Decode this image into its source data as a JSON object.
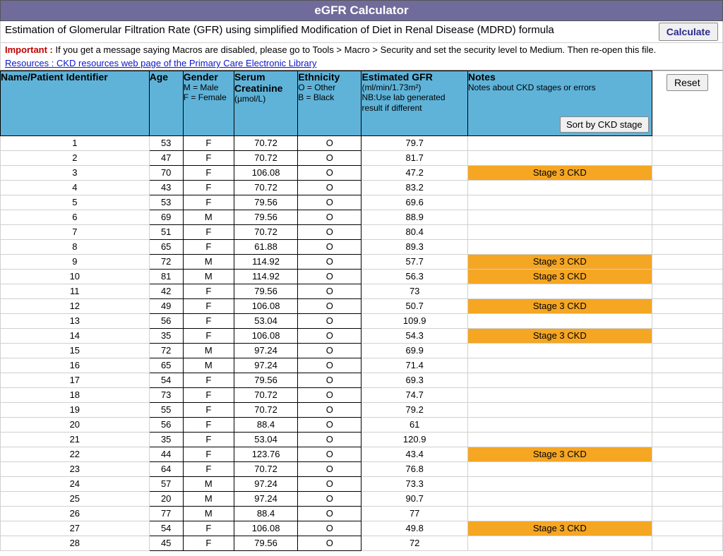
{
  "title": "eGFR Calculator",
  "subtitle": "Estimation of Glomerular Filtration Rate (GFR) using simplified Modification of Diet in Renal Disease (MDRD) formula",
  "buttons": {
    "calculate": "Calculate",
    "reset": "Reset",
    "sort": "Sort by CKD stage"
  },
  "important": {
    "label": "Important :",
    "text": " If you get a message saying Macros are disabled, please go to Tools > Macro > Security and set the security level to Medium. Then re-open this file."
  },
  "resources_link": "Resources : CKD resources web page of the Primary Care Electronic Library",
  "columns": {
    "id": {
      "title": "Name/Patient Identifier",
      "sub": ""
    },
    "age": {
      "title": "Age",
      "sub": ""
    },
    "gender": {
      "title": "Gender",
      "sub": "M = Male\nF = Female"
    },
    "creat": {
      "title": "Serum Creatinine",
      "sub": "(µmol/L)"
    },
    "eth": {
      "title": "Ethnicity",
      "sub": "O = Other\nB = Black"
    },
    "gfr": {
      "title": "Estimated GFR",
      "sub": "(ml/min/1.73m²)\nNB:Use lab generated result if different"
    },
    "notes": {
      "title": "Notes",
      "sub": "Notes about CKD stages or errors"
    }
  },
  "rows": [
    {
      "id": "1",
      "age": "53",
      "gender": "F",
      "creat": "70.72",
      "eth": "O",
      "gfr": "79.7",
      "notes": ""
    },
    {
      "id": "2",
      "age": "47",
      "gender": "F",
      "creat": "70.72",
      "eth": "O",
      "gfr": "81.7",
      "notes": ""
    },
    {
      "id": "3",
      "age": "70",
      "gender": "F",
      "creat": "106.08",
      "eth": "O",
      "gfr": "47.2",
      "notes": "Stage 3 CKD"
    },
    {
      "id": "4",
      "age": "43",
      "gender": "F",
      "creat": "70.72",
      "eth": "O",
      "gfr": "83.2",
      "notes": ""
    },
    {
      "id": "5",
      "age": "53",
      "gender": "F",
      "creat": "79.56",
      "eth": "O",
      "gfr": "69.6",
      "notes": ""
    },
    {
      "id": "6",
      "age": "69",
      "gender": "M",
      "creat": "79.56",
      "eth": "O",
      "gfr": "88.9",
      "notes": ""
    },
    {
      "id": "7",
      "age": "51",
      "gender": "F",
      "creat": "70.72",
      "eth": "O",
      "gfr": "80.4",
      "notes": ""
    },
    {
      "id": "8",
      "age": "65",
      "gender": "F",
      "creat": "61.88",
      "eth": "O",
      "gfr": "89.3",
      "notes": ""
    },
    {
      "id": "9",
      "age": "72",
      "gender": "M",
      "creat": "114.92",
      "eth": "O",
      "gfr": "57.7",
      "notes": "Stage 3 CKD"
    },
    {
      "id": "10",
      "age": "81",
      "gender": "M",
      "creat": "114.92",
      "eth": "O",
      "gfr": "56.3",
      "notes": "Stage 3 CKD"
    },
    {
      "id": "11",
      "age": "42",
      "gender": "F",
      "creat": "79.56",
      "eth": "O",
      "gfr": "73",
      "notes": ""
    },
    {
      "id": "12",
      "age": "49",
      "gender": "F",
      "creat": "106.08",
      "eth": "O",
      "gfr": "50.7",
      "notes": "Stage 3 CKD"
    },
    {
      "id": "13",
      "age": "56",
      "gender": "F",
      "creat": "53.04",
      "eth": "O",
      "gfr": "109.9",
      "notes": ""
    },
    {
      "id": "14",
      "age": "35",
      "gender": "F",
      "creat": "106.08",
      "eth": "O",
      "gfr": "54.3",
      "notes": "Stage 3 CKD"
    },
    {
      "id": "15",
      "age": "72",
      "gender": "M",
      "creat": "97.24",
      "eth": "O",
      "gfr": "69.9",
      "notes": ""
    },
    {
      "id": "16",
      "age": "65",
      "gender": "M",
      "creat": "97.24",
      "eth": "O",
      "gfr": "71.4",
      "notes": ""
    },
    {
      "id": "17",
      "age": "54",
      "gender": "F",
      "creat": "79.56",
      "eth": "O",
      "gfr": "69.3",
      "notes": ""
    },
    {
      "id": "18",
      "age": "73",
      "gender": "F",
      "creat": "70.72",
      "eth": "O",
      "gfr": "74.7",
      "notes": ""
    },
    {
      "id": "19",
      "age": "55",
      "gender": "F",
      "creat": "70.72",
      "eth": "O",
      "gfr": "79.2",
      "notes": ""
    },
    {
      "id": "20",
      "age": "56",
      "gender": "F",
      "creat": "88.4",
      "eth": "O",
      "gfr": "61",
      "notes": ""
    },
    {
      "id": "21",
      "age": "35",
      "gender": "F",
      "creat": "53.04",
      "eth": "O",
      "gfr": "120.9",
      "notes": ""
    },
    {
      "id": "22",
      "age": "44",
      "gender": "F",
      "creat": "123.76",
      "eth": "O",
      "gfr": "43.4",
      "notes": "Stage 3 CKD"
    },
    {
      "id": "23",
      "age": "64",
      "gender": "F",
      "creat": "70.72",
      "eth": "O",
      "gfr": "76.8",
      "notes": ""
    },
    {
      "id": "24",
      "age": "57",
      "gender": "M",
      "creat": "97.24",
      "eth": "O",
      "gfr": "73.3",
      "notes": ""
    },
    {
      "id": "25",
      "age": "20",
      "gender": "M",
      "creat": "97.24",
      "eth": "O",
      "gfr": "90.7",
      "notes": ""
    },
    {
      "id": "26",
      "age": "77",
      "gender": "M",
      "creat": "88.4",
      "eth": "O",
      "gfr": "77",
      "notes": ""
    },
    {
      "id": "27",
      "age": "54",
      "gender": "F",
      "creat": "106.08",
      "eth": "O",
      "gfr": "49.8",
      "notes": "Stage 3 CKD"
    },
    {
      "id": "28",
      "age": "45",
      "gender": "F",
      "creat": "79.56",
      "eth": "O",
      "gfr": "72",
      "notes": ""
    }
  ]
}
